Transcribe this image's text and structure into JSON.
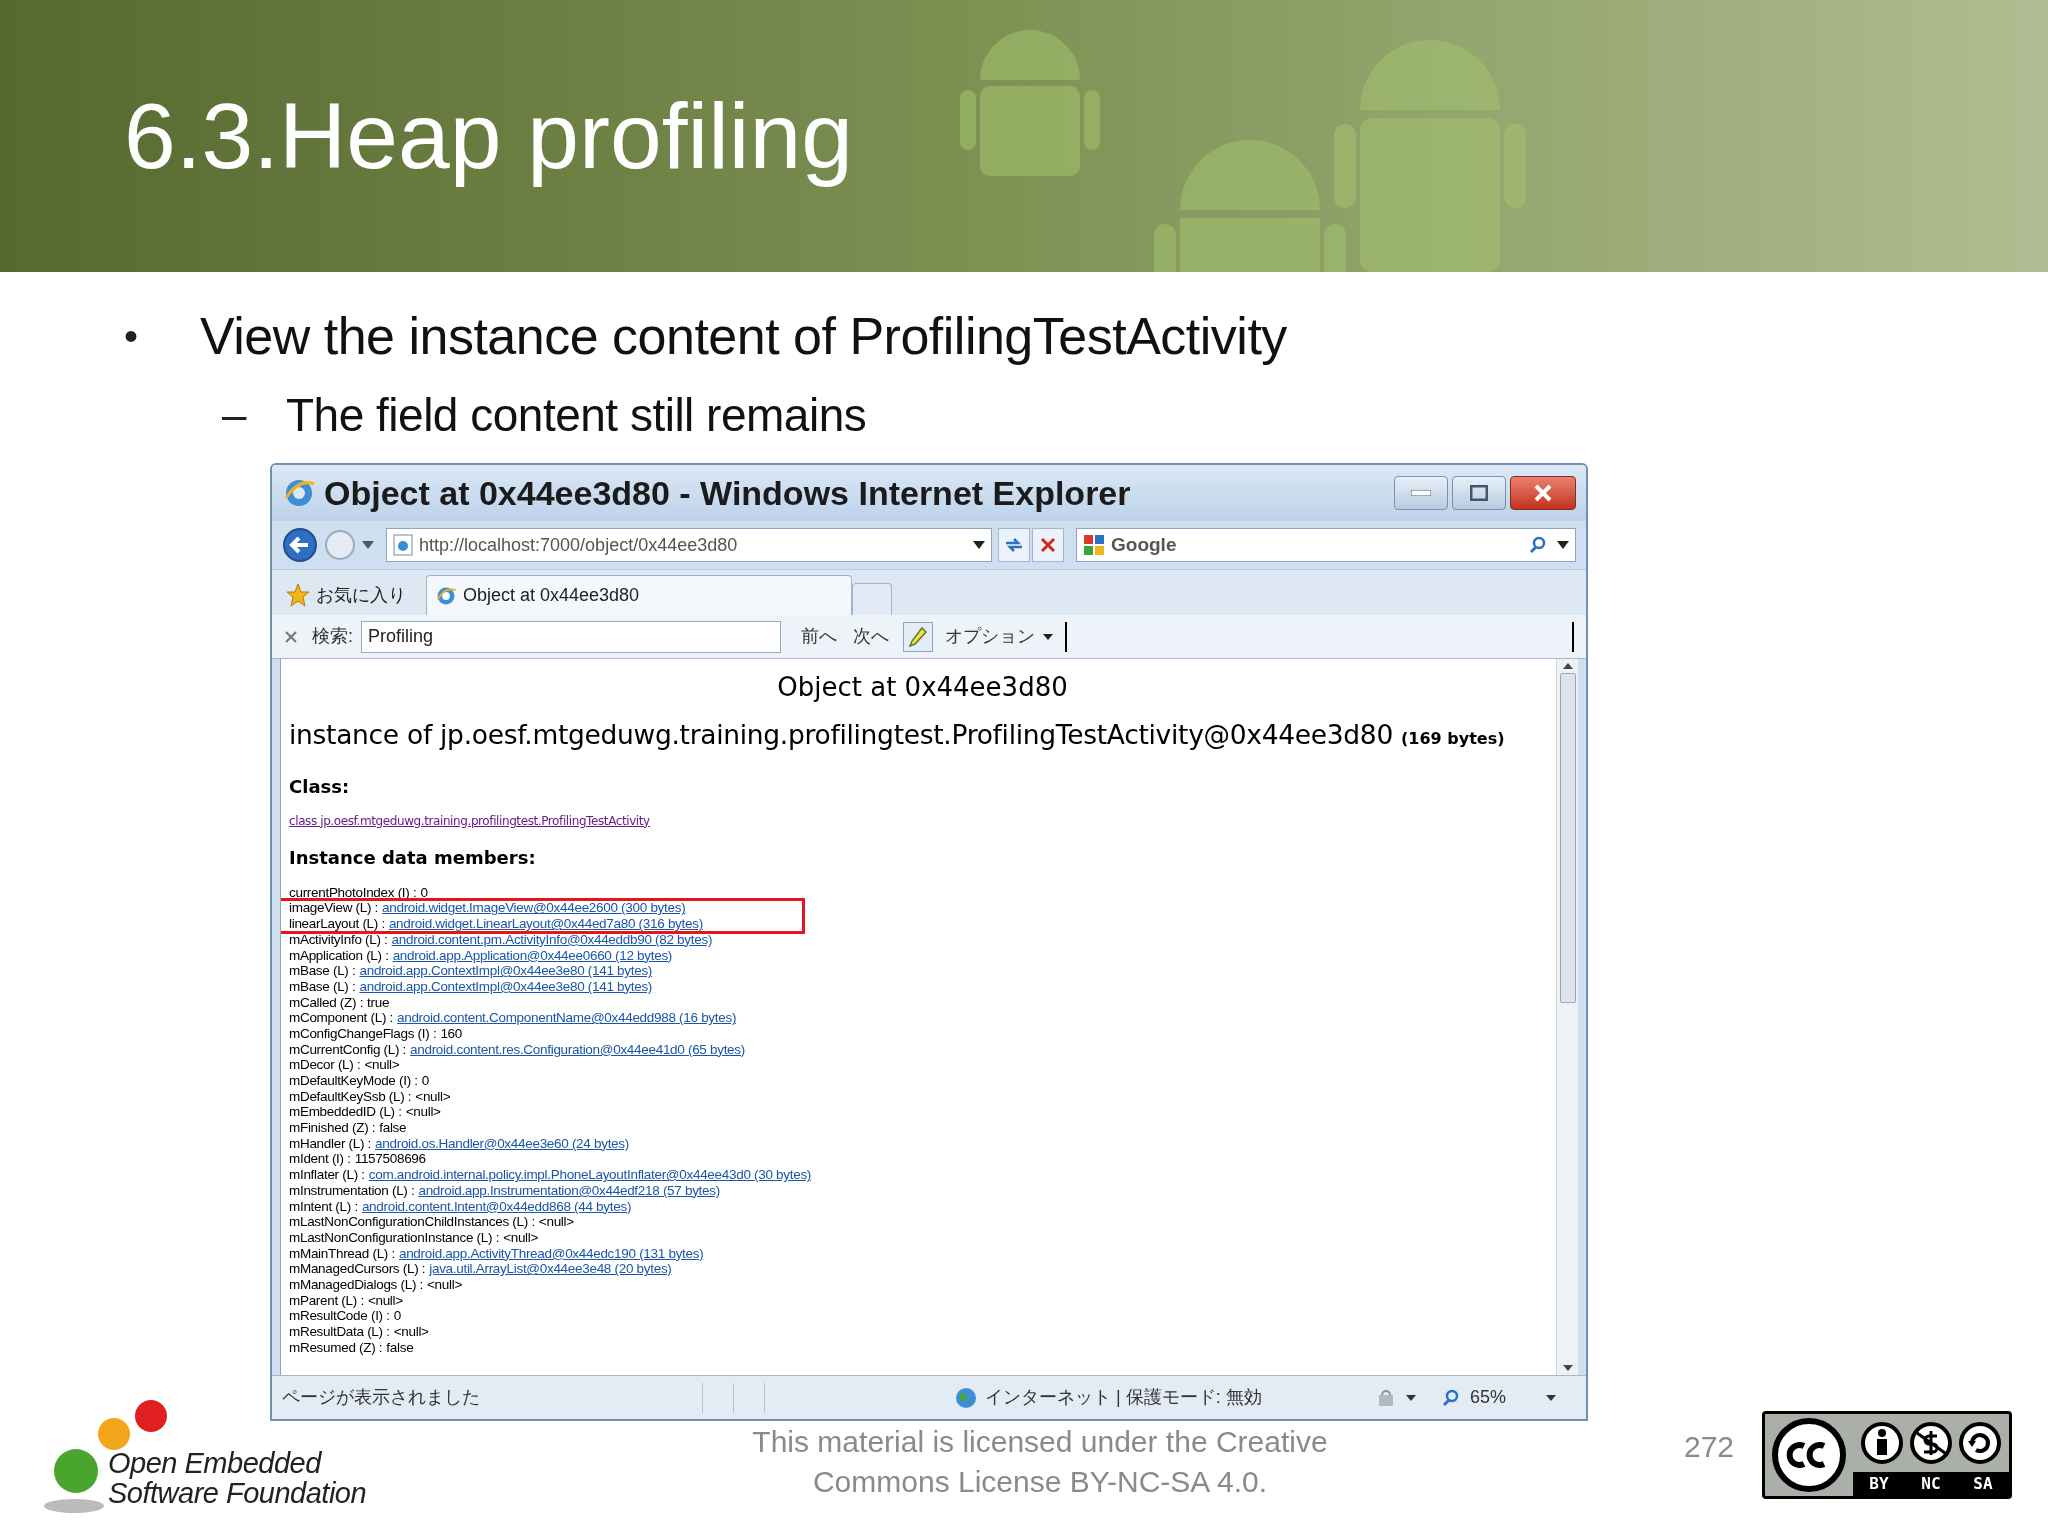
{
  "slide": {
    "title": "6.3.Heap profiling",
    "bullets": [
      {
        "marker": "•",
        "text": "View the instance content of ProfilingTestActivity",
        "children": [
          {
            "marker": "–",
            "text": "The field content still remains"
          }
        ]
      }
    ]
  },
  "browser": {
    "title": "Object at 0x44ee3d80 - Windows Internet Explorer",
    "address": "http://localhost:7000/object/0x44ee3d80",
    "search_engine": "Google",
    "favorites": "お気に入り",
    "tabs": [
      {
        "label": "Object at 0x44ee3d80",
        "selected": true
      }
    ],
    "find_bar": {
      "label": "検索:",
      "value": "Profiling",
      "prev": "前へ",
      "next": "次へ",
      "options": "オプション"
    },
    "page": {
      "heading": "Object at 0x44ee3d80",
      "instance": "instance of jp.oesf.mtgeduwg.training.profilingtest.ProfilingTestActivity@0x44ee3d80",
      "size": "(169 bytes)",
      "class_label": "Class:",
      "class_link": "class jp.oesf.mtgeduwg.training.profilingtest.ProfilingTestActivity",
      "members_label": "Instance data members:",
      "members": [
        {
          "field": "currentPhotoIndex (I) :",
          "value": "0",
          "kind": "text",
          "highlighted": false
        },
        {
          "field": "imageView (L) :",
          "value": "android.widget.ImageView@0x44ee2600 (300 bytes)",
          "kind": "link",
          "highlighted": true
        },
        {
          "field": "linearLayout (L) :",
          "value": "android.widget.LinearLayout@0x44ed7a80 (316 bytes)",
          "kind": "link",
          "highlighted": true
        },
        {
          "field": "mActivityInfo (L) :",
          "value": "android.content.pm.ActivityInfo@0x44eddb90 (82 bytes)",
          "kind": "link",
          "highlighted": false
        },
        {
          "field": "mApplication (L) :",
          "value": "android.app.Application@0x44ee0660 (12 bytes)",
          "kind": "link",
          "highlighted": false
        },
        {
          "field": "mBase (L) :",
          "value": "android.app.ContextImpl@0x44ee3e80 (141 bytes)",
          "kind": "link",
          "highlighted": false
        },
        {
          "field": "mBase (L) :",
          "value": "android.app.ContextImpl@0x44ee3e80 (141 bytes)",
          "kind": "link",
          "highlighted": false
        },
        {
          "field": "mCalled (Z) :",
          "value": "true",
          "kind": "text",
          "highlighted": false
        },
        {
          "field": "mComponent (L) :",
          "value": "android.content.ComponentName@0x44edd988 (16 bytes)",
          "kind": "link",
          "highlighted": false
        },
        {
          "field": "mConfigChangeFlags (I) :",
          "value": "160",
          "kind": "text",
          "highlighted": false
        },
        {
          "field": "mCurrentConfig (L) :",
          "value": "android.content.res.Configuration@0x44ee41d0 (65 bytes)",
          "kind": "link",
          "highlighted": false
        },
        {
          "field": "mDecor (L) :",
          "value": "<null>",
          "kind": "text",
          "highlighted": false
        },
        {
          "field": "mDefaultKeyMode (I) :",
          "value": "0",
          "kind": "text",
          "highlighted": false
        },
        {
          "field": "mDefaultKeySsb (L) :",
          "value": "<null>",
          "kind": "text",
          "highlighted": false
        },
        {
          "field": "mEmbeddedID (L) :",
          "value": "<null>",
          "kind": "text",
          "highlighted": false
        },
        {
          "field": "mFinished (Z) :",
          "value": "false",
          "kind": "text",
          "highlighted": false
        },
        {
          "field": "mHandler (L) :",
          "value": "android.os.Handler@0x44ee3e60 (24 bytes)",
          "kind": "link",
          "highlighted": false
        },
        {
          "field": "mIdent (I) :",
          "value": "1157508696",
          "kind": "text",
          "highlighted": false
        },
        {
          "field": "mInflater (L) :",
          "value": "com.android.internal.policy.impl.PhoneLayoutInflater@0x44ee43d0 (30 bytes)",
          "kind": "link",
          "highlighted": false
        },
        {
          "field": "mInstrumentation (L) :",
          "value": "android.app.Instrumentation@0x44edf218 (57 bytes)",
          "kind": "link",
          "highlighted": false
        },
        {
          "field": "mIntent (L) :",
          "value": "android.content.Intent@0x44edd868 (44 bytes)",
          "kind": "link",
          "highlighted": false
        },
        {
          "field": "mLastNonConfigurationChildInstances (L) :",
          "value": "<null>",
          "kind": "text",
          "highlighted": false
        },
        {
          "field": "mLastNonConfigurationInstance (L) :",
          "value": "<null>",
          "kind": "text",
          "highlighted": false
        },
        {
          "field": "mMainThread (L) :",
          "value": "android.app.ActivityThread@0x44edc190 (131 bytes)",
          "kind": "link",
          "highlighted": false
        },
        {
          "field": "mManagedCursors (L) :",
          "value": "java.util.ArrayList@0x44ee3e48 (20 bytes)",
          "kind": "link",
          "highlighted": false
        },
        {
          "field": "mManagedDialogs (L) :",
          "value": "<null>",
          "kind": "text",
          "highlighted": false
        },
        {
          "field": "mParent (L) :",
          "value": "<null>",
          "kind": "text",
          "highlighted": false
        },
        {
          "field": "mResultCode (I) :",
          "value": "0",
          "kind": "text",
          "highlighted": false
        },
        {
          "field": "mResultData (L) :",
          "value": "<null>",
          "kind": "text",
          "highlighted": false
        },
        {
          "field": "mResumed (Z) :",
          "value": "false",
          "kind": "text",
          "highlighted": false
        }
      ]
    },
    "status_bar": {
      "message": "ページが表示されました",
      "zone": "インターネット | 保護モード: 無効",
      "zoom": "65%"
    }
  },
  "footer": {
    "logo_lines": [
      "Open Embedded",
      "Software Foundation"
    ],
    "license_lines": [
      "This material is licensed under the Creative",
      "Commons License BY-NC-SA 4.0."
    ],
    "page_number": "272",
    "cc_labels": [
      "BY",
      "NC",
      "SA"
    ]
  }
}
